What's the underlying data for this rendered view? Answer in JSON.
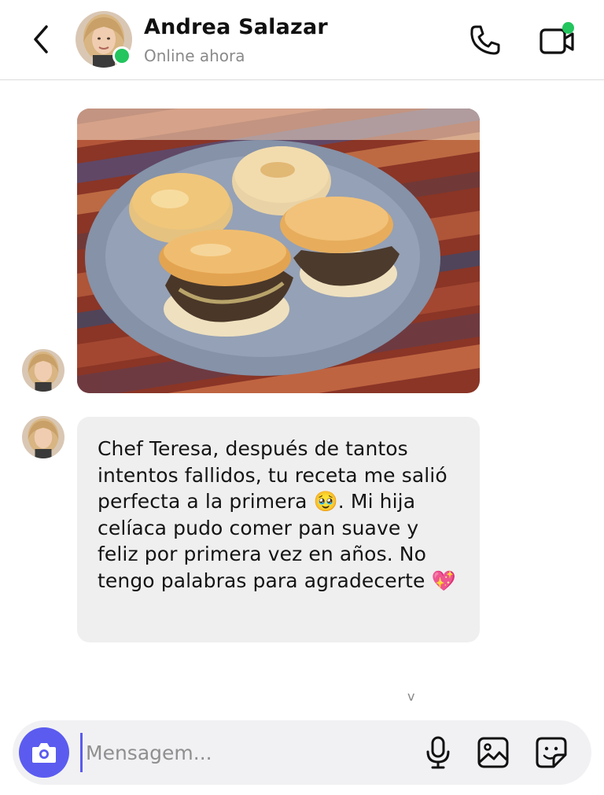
{
  "header": {
    "contact_name": "Andrea Salazar",
    "status": "Online ahora",
    "icons": {
      "back": "chevron-left-icon",
      "call": "phone-icon",
      "video": "video-call-icon"
    }
  },
  "messages": [
    {
      "type": "image",
      "sender": "Andrea Salazar",
      "image_description_icon": "photo-arepas"
    },
    {
      "type": "text",
      "sender": "Andrea Salazar",
      "text": "Chef Teresa, después de tantos intentos fallidos, tu receta me salió perfecta a la primera 🥹. Mi hija celíaca pudo comer pan suave y feliz por primera vez en años. No tengo palabras para agradecerte 💖"
    }
  ],
  "scroll_hint": "v",
  "composer": {
    "placeholder": "Mensagem...",
    "value": "",
    "icons": {
      "camera": "camera-icon",
      "mic": "microphone-icon",
      "gallery": "image-icon",
      "sticker": "sticker-icon"
    }
  },
  "colors": {
    "accent": "#5b5bf0",
    "online": "#22c55e",
    "bubble": "#efefef"
  }
}
